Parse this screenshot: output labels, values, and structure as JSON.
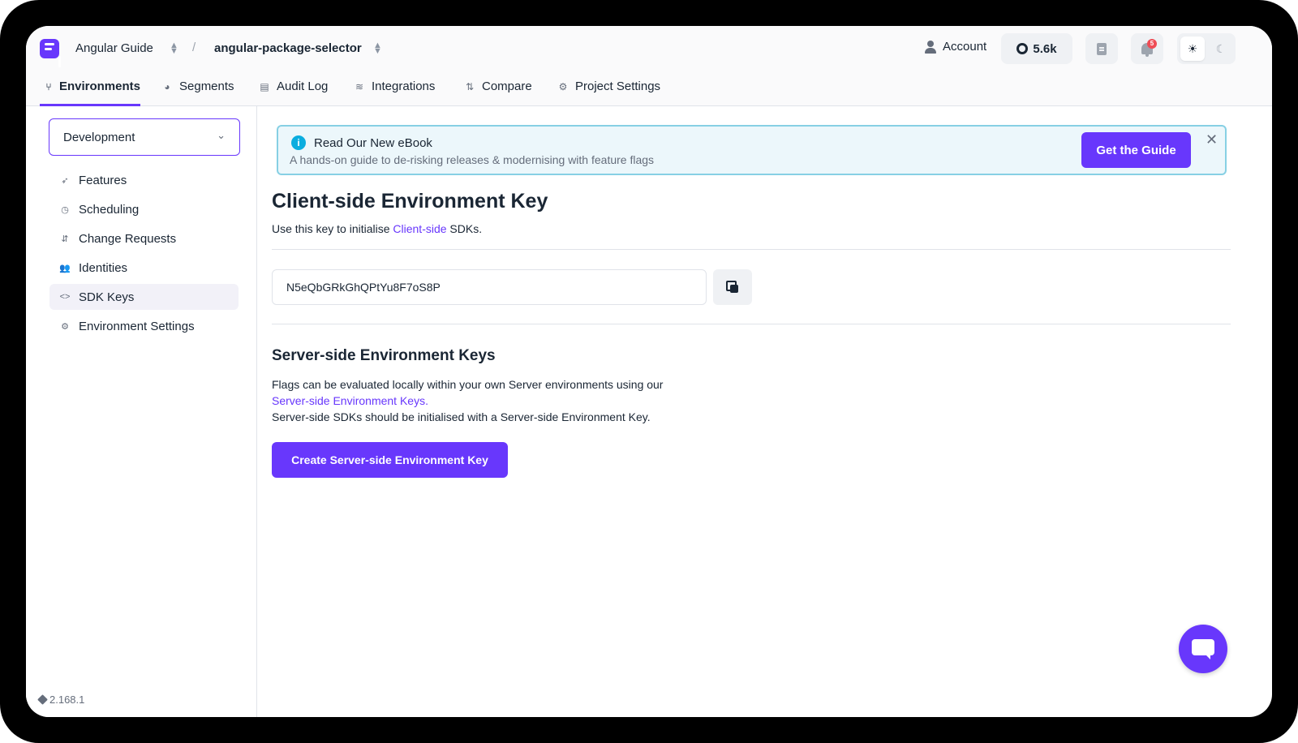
{
  "header": {
    "org": "Angular Guide",
    "separator": "/",
    "project": "angular-package-selector",
    "account_label": "Account",
    "github_stars": "5.6k",
    "notification_count": "5"
  },
  "tabs": [
    {
      "label": "Environments",
      "icon": "branch-icon",
      "active": true
    },
    {
      "label": "Segments",
      "icon": "pie-icon"
    },
    {
      "label": "Audit Log",
      "icon": "log-icon"
    },
    {
      "label": "Integrations",
      "icon": "layers-icon"
    },
    {
      "label": "Compare",
      "icon": "compare-icon"
    },
    {
      "label": "Project Settings",
      "icon": "gear-icon"
    }
  ],
  "sidebar": {
    "environment": "Development",
    "items": [
      {
        "label": "Features",
        "icon": "rocket-icon"
      },
      {
        "label": "Scheduling",
        "icon": "clock-icon"
      },
      {
        "label": "Change Requests",
        "icon": "pull-request-icon"
      },
      {
        "label": "Identities",
        "icon": "users-icon"
      },
      {
        "label": "SDK Keys",
        "icon": "code-icon",
        "active": true
      },
      {
        "label": "Environment Settings",
        "icon": "gear-icon"
      }
    ],
    "version": "2.168.1"
  },
  "banner": {
    "title": "Read Our New eBook",
    "subtitle": "A hands-on guide to de-risking releases & modernising with feature flags",
    "button": "Get the Guide",
    "close": "✕"
  },
  "client": {
    "heading": "Client-side Environment Key",
    "desc_before": "Use this key to initialise ",
    "desc_link": "Client-side",
    "desc_after": " SDKs.",
    "key": "N5eQbGRkGhQPtYu8F7oS8P"
  },
  "server": {
    "heading": "Server-side Environment Keys",
    "line1": "Flags can be evaluated locally within your own Server environments using our",
    "link": "Server-side Environment Keys.",
    "line3": "Server-side SDKs should be initialised with a Server-side Environment Key.",
    "button": "Create Server-side Environment Key"
  },
  "colors": {
    "accent": "#6837fc",
    "banner_bg": "#ecf7fb",
    "banner_border": "#87d0e4",
    "info": "#0aaddf"
  }
}
